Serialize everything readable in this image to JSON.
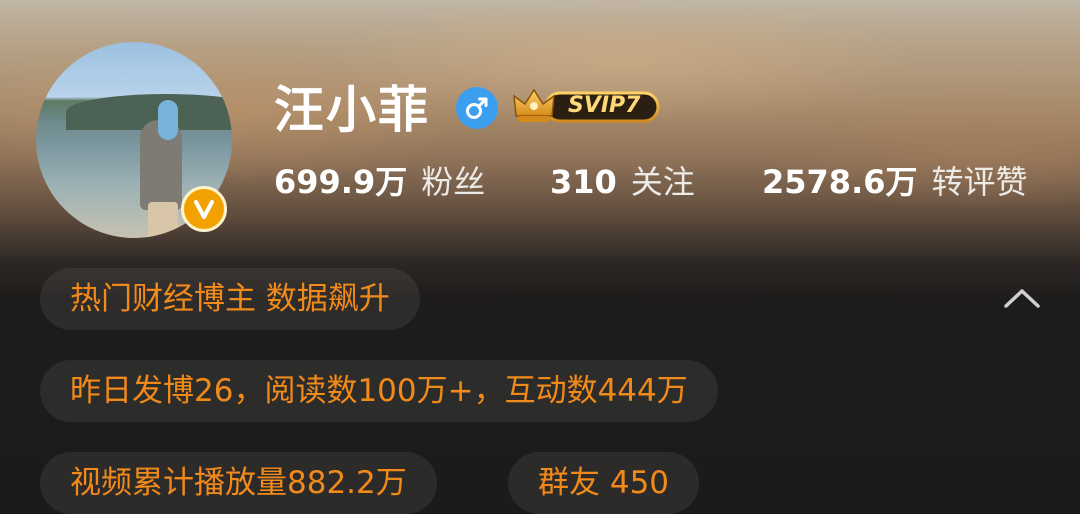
{
  "profile": {
    "name": "汪小菲",
    "gender_icon": "male-symbol",
    "verified_icon": "v-verified-badge",
    "membership_badge": "SVIP7"
  },
  "stats": [
    {
      "value": "699.9万",
      "label": "粉丝"
    },
    {
      "value": "310",
      "label": "关注"
    },
    {
      "value": "2578.6万",
      "label": "转评赞"
    }
  ],
  "tags": {
    "headline": "热门财经博主 数据飙升",
    "yesterday": "昨日发博26，阅读数100万+，互动数444万",
    "video": "视频累计播放量882.2万",
    "group": "群友 450"
  },
  "colors": {
    "accent_orange": "#f28a1a",
    "verified_gold": "#f2a100",
    "gender_blue": "#3b9eef",
    "svip_gold": "#e7a83a",
    "background_dark": "#1c1b1a"
  },
  "icons": {
    "collapse": "chevron-up-icon"
  }
}
